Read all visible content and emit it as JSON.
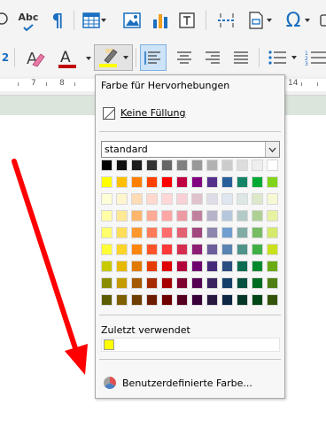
{
  "toolbar": {
    "row1": [
      {
        "name": "spellcheck-icon",
        "glyph": "Abc"
      },
      {
        "name": "formatting-marks-icon",
        "glyph": "¶"
      },
      {
        "name": "insert-table-icon"
      },
      {
        "name": "insert-image-icon"
      },
      {
        "name": "insert-chart-icon"
      },
      {
        "name": "insert-text-box-icon"
      },
      {
        "name": "insert-page-break-icon"
      },
      {
        "name": "insert-field-icon"
      },
      {
        "name": "insert-special-character-icon",
        "glyph": "Ω"
      }
    ],
    "superscript_glyph": "2",
    "font_color": "#c00000",
    "highlight_color": "#ffff00"
  },
  "ruler": {
    "numbers": [
      "7",
      "8",
      "14"
    ]
  },
  "popup": {
    "title": "Farbe für Hervorhebungen",
    "no_fill_label": "Keine Füllung",
    "palette_select": "standard",
    "recent_label": "Zuletzt verwendet",
    "recent_colors": [
      "#ffff00"
    ],
    "custom_color_label": "Benutzerdefinierte Farbe..."
  },
  "palette": [
    [
      "#000000",
      "#111111",
      "#1c1c1c",
      "#333333",
      "#666666",
      "#808080",
      "#999999",
      "#b2b2b2",
      "#cccccc",
      "#dddddd",
      "#eeeeee",
      "#ffffff"
    ],
    [
      "#ffff00",
      "#ffbf00",
      "#ff8000",
      "#ff4000",
      "#ff0000",
      "#bf0041",
      "#800080",
      "#55308d",
      "#2a6099",
      "#158466",
      "#00a933",
      "#81d41a"
    ],
    [
      "#ffffd7",
      "#fff5ce",
      "#ffdbb6",
      "#ffd8ce",
      "#ffd7d7",
      "#f7d1d5",
      "#e0c2cd",
      "#dedce6",
      "#dee6ef",
      "#dee7e5",
      "#dde8cb",
      "#f6f9d4"
    ],
    [
      "#ffffa6",
      "#ffe994",
      "#ffb66c",
      "#ffaa95",
      "#ffa6a6",
      "#ec9ba4",
      "#bf819e",
      "#b7b3ca",
      "#b4c7dc",
      "#b3cac7",
      "#afd095",
      "#e8f2a1"
    ],
    [
      "#ffff6d",
      "#ffde59",
      "#ff972f",
      "#ff7b59",
      "#ff6d6d",
      "#e16173",
      "#a1467e",
      "#8e86ae",
      "#729fcf",
      "#81aca6",
      "#77bc65",
      "#d4ea6b"
    ],
    [
      "#ffff38",
      "#ffd428",
      "#ff860d",
      "#ff5429",
      "#ff3838",
      "#d62e4e",
      "#8d1d75",
      "#6b5e9b",
      "#5983b0",
      "#50938a",
      "#3faf46",
      "#c9e11c"
    ],
    [
      "#c9c900",
      "#e6b800",
      "#e27a00",
      "#e63c00",
      "#e00000",
      "#b3003a",
      "#6d006d",
      "#47297a",
      "#2a4e80",
      "#0d6b52",
      "#008a2b",
      "#6aab14"
    ],
    [
      "#8c8c00",
      "#c49b00",
      "#a65a00",
      "#a62b00",
      "#a60000",
      "#7e0030",
      "#550055",
      "#3b2361",
      "#153e69",
      "#05503e",
      "#006b21",
      "#4f7f12"
    ],
    [
      "#5c5c00",
      "#7f6000",
      "#6e3d00",
      "#6e1c00",
      "#6e0000",
      "#55001f",
      "#3a003a",
      "#27183f",
      "#0c2744",
      "#033728",
      "#004716",
      "#345409"
    ]
  ]
}
